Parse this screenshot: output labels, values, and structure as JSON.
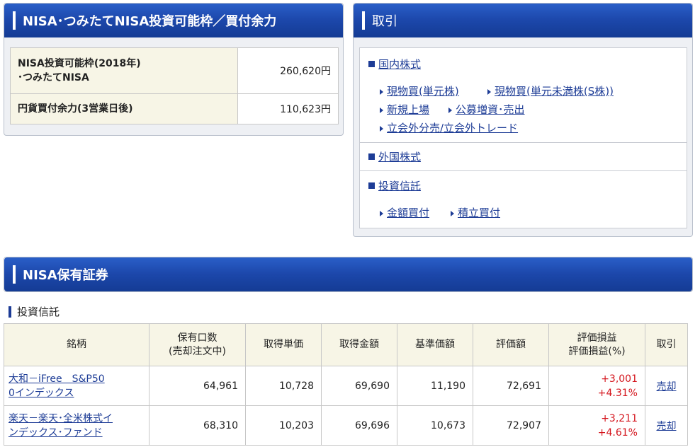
{
  "nisa_panel": {
    "title": "NISA･つみたてNISA投資可能枠／買付余力",
    "rows": [
      {
        "label_line1": "NISA投資可能枠(2018年)",
        "label_line2": "･つみたてNISA",
        "value": "260,620円"
      },
      {
        "label_line1": "円貨買付余力(3営業日後)",
        "label_line2": "",
        "value": "110,623円"
      }
    ]
  },
  "trade_panel": {
    "title": "取引",
    "domestic": {
      "title": "国内株式",
      "links": [
        "現物買(単元株)",
        "現物買(単元未満株(S株))",
        "新規上場",
        "公募増資･売出",
        "立会外分売/立会外トレード"
      ]
    },
    "foreign": {
      "title": "外国株式"
    },
    "fund": {
      "title": "投資信託",
      "links": [
        "金額買付",
        "積立買付"
      ]
    }
  },
  "holdings": {
    "title": "NISA保有証券",
    "subtitle": "投資信託",
    "headers": [
      "銘柄",
      "保有口数",
      "(売却注文中)",
      "取得単価",
      "取得金額",
      "基準価額",
      "評価額",
      "評価損益",
      "評価損益(%)",
      "取引"
    ],
    "rows": [
      {
        "name1": "大和－iFree　S&P50",
        "name2": "0インデックス",
        "units": "64,961",
        "unit_cost": "10,728",
        "cost": "69,690",
        "nav": "11,190",
        "value": "72,691",
        "pl": "+3,001",
        "pl_pct": "+4.31%",
        "action": "売却"
      },
      {
        "name1": "楽天－楽天･全米株式イ",
        "name2": "ンデックス･ファンド",
        "units": "68,310",
        "unit_cost": "10,203",
        "cost": "69,696",
        "nav": "10,673",
        "value": "72,907",
        "pl": "+3,211",
        "pl_pct": "+4.61%",
        "action": "売却"
      }
    ]
  },
  "colors": {
    "header_blue": "#1c47aa",
    "link_blue": "#1d3c96",
    "gain_red": "#d4141c",
    "label_bg": "#f7f5e6"
  }
}
